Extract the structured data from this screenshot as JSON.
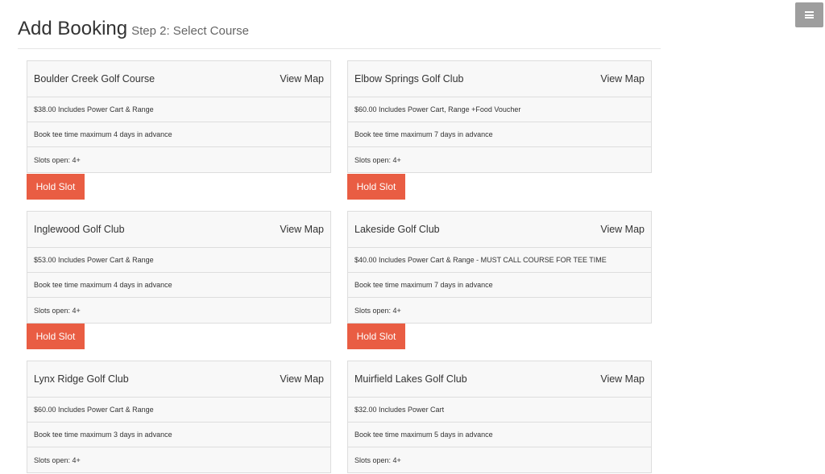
{
  "header": {
    "title": "Add Booking",
    "subtitle": "Step 2: Select Course"
  },
  "menu": {
    "icon": "hamburger-icon"
  },
  "colors": {
    "hold_button": "#e95d43",
    "menu_button": "#9e9e9e"
  },
  "courses": [
    {
      "name": "Boulder Creek Golf Course",
      "map_label": "View Map",
      "price": "$38.00 Includes Power Cart & Range",
      "advance": "Book tee time maximum 4 days in advance",
      "slots": "Slots open: 4+",
      "hold_label": "Hold Slot"
    },
    {
      "name": "Elbow Springs Golf Club",
      "map_label": "View Map",
      "price": "$60.00 Includes Power Cart, Range +Food Voucher",
      "advance": "Book tee time maximum 7 days in advance",
      "slots": "Slots open: 4+",
      "hold_label": "Hold Slot"
    },
    {
      "name": "Inglewood Golf Club",
      "map_label": "View Map",
      "price": "$53.00 Includes Power Cart & Range",
      "advance": "Book tee time maximum 4 days in advance",
      "slots": "Slots open: 4+",
      "hold_label": "Hold Slot"
    },
    {
      "name": "Lakeside Golf Club",
      "map_label": "View Map",
      "price": "$40.00 Includes Power Cart & Range - MUST CALL COURSE FOR TEE TIME",
      "advance": "Book tee time maximum 7 days in advance",
      "slots": "Slots open: 4+",
      "hold_label": "Hold Slot"
    },
    {
      "name": "Lynx Ridge Golf Club",
      "map_label": "View Map",
      "price": "$60.00 Includes Power Cart & Range",
      "advance": "Book tee time maximum 3 days in advance",
      "slots": "Slots open: 4+"
    },
    {
      "name": "Muirfield Lakes Golf Club",
      "map_label": "View Map",
      "price": "$32.00 Includes Power Cart",
      "advance": "Book tee time maximum 5 days in advance",
      "slots": "Slots open: 4+"
    }
  ]
}
